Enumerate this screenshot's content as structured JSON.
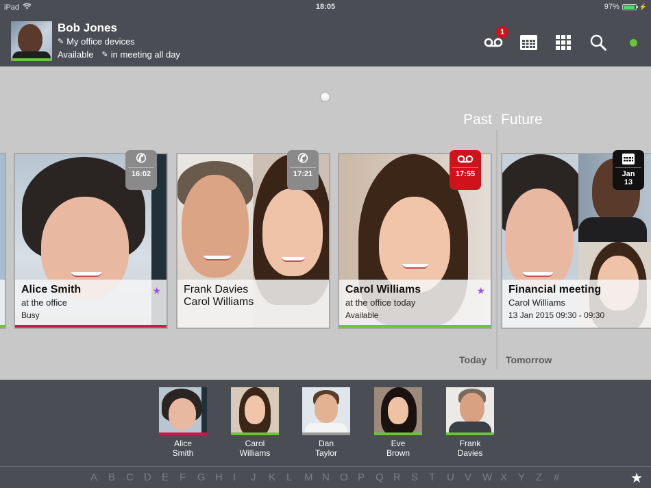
{
  "status_bar": {
    "device": "iPad",
    "time": "18:05",
    "battery": "97%",
    "battery_level": 0.97
  },
  "user": {
    "name": "Bob Jones",
    "devices": "My office devices",
    "presence": "Available",
    "note": "in meeting all day",
    "presence_color": "#6bc43a"
  },
  "header_icons": {
    "voicemail_badge": "1"
  },
  "timeline": {
    "past_label": "Past",
    "future_label": "Future",
    "today_label": "Today",
    "tomorrow_label": "Tomorrow"
  },
  "cards": [
    {
      "title": "Alice Smith",
      "subtitle": "at the office",
      "status": "Busy",
      "status_color": "#d0174a",
      "favorite": true,
      "tag_type": "call",
      "tag_text": "16:02",
      "tag_color": "#8a8a8a"
    },
    {
      "title": "Frank Davies",
      "subtitle": "Carol Williams",
      "status": "",
      "favorite": false,
      "tag_type": "call",
      "tag_text": "17:21",
      "tag_color": "#8a8a8a"
    },
    {
      "title": "Carol Williams",
      "subtitle": "at the office today",
      "status": "Available",
      "status_color": "#6bc43a",
      "favorite": true,
      "tag_type": "voicemail",
      "tag_text": "17:55",
      "tag_color": "#d0121b"
    },
    {
      "title": "Financial meeting",
      "subtitle": "Carol Williams",
      "status": "13 Jan 2015 09:30 - 09:30",
      "favorite": false,
      "tag_type": "calendar",
      "tag_text_month": "Jan",
      "tag_text_day": "13",
      "tag_color": "#111111"
    }
  ],
  "favorites": [
    {
      "first": "Alice",
      "last": "Smith",
      "presence_color": "#d0174a"
    },
    {
      "first": "Carol",
      "last": "Williams",
      "presence_color": "#6bc43a"
    },
    {
      "first": "Dan",
      "last": "Taylor",
      "presence_color": "#9a9a9a"
    },
    {
      "first": "Eve",
      "last": "Brown",
      "presence_color": "#6bc43a"
    },
    {
      "first": "Frank",
      "last": "Davies",
      "presence_color": "#6bc43a"
    }
  ],
  "alphabet": [
    "A",
    "B",
    "C",
    "D",
    "E",
    "F",
    "G",
    "H",
    "I",
    "J",
    "K",
    "L",
    "M",
    "N",
    "O",
    "P",
    "Q",
    "R",
    "S",
    "T",
    "U",
    "V",
    "W",
    "X",
    "Y",
    "Z",
    "#"
  ],
  "alphabet_star": "★"
}
